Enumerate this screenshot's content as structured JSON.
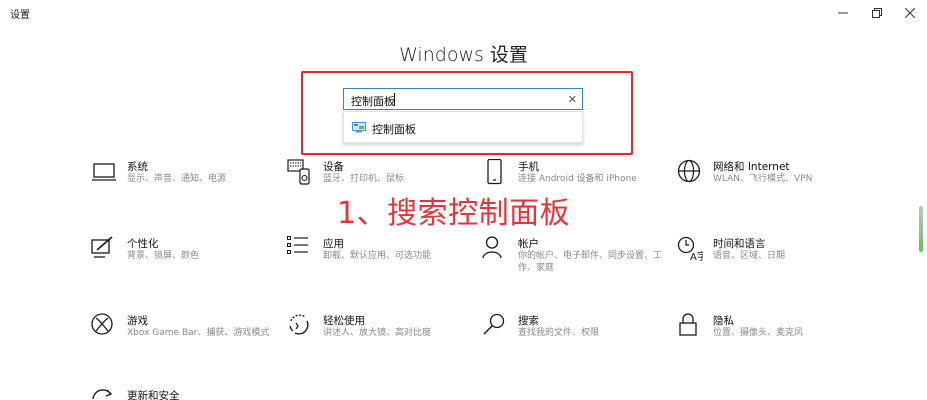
{
  "window": {
    "title": "设置",
    "minimize_icon": "minimize-icon",
    "restore_icon": "restore-icon",
    "close_icon": "close-icon"
  },
  "page": {
    "title": "Windows 设置"
  },
  "search": {
    "value": "控制面板",
    "clear_icon": "close-icon"
  },
  "suggestion": {
    "label": "控制面板",
    "icon": "control-panel-icon"
  },
  "annotation": {
    "text": "1、搜索控制面板",
    "color": "#e5343b"
  },
  "highlight_color": "#e0282e",
  "tiles": [
    {
      "name": "系统",
      "desc": "显示、声音、通知、电源",
      "icon": "laptop-icon"
    },
    {
      "name": "设备",
      "desc": "蓝牙、打印机、鼠标",
      "icon": "devices-icon"
    },
    {
      "name": "手机",
      "desc": "连接 Android 设备和 iPhone",
      "icon": "phone-icon"
    },
    {
      "name": "网络和 Internet",
      "desc": "WLAN、飞行模式、VPN",
      "icon": "globe-icon"
    },
    {
      "name": "个性化",
      "desc": "背景、锁屏、颜色",
      "icon": "personalization-icon"
    },
    {
      "name": "应用",
      "desc": "卸载、默认应用、可选功能",
      "icon": "apps-list-icon"
    },
    {
      "name": "帐户",
      "desc": "你的帐户、电子邮件、同步设置、工作、家庭",
      "icon": "person-icon"
    },
    {
      "name": "时间和语言",
      "desc": "语音、区域、日期",
      "icon": "time-language-icon"
    },
    {
      "name": "游戏",
      "desc": "Xbox Game Bar、捕获、游戏模式",
      "icon": "xbox-icon"
    },
    {
      "name": "轻松使用",
      "desc": "讲述人、放大镜、高对比度",
      "icon": "ease-of-access-icon"
    },
    {
      "name": "搜索",
      "desc": "查找我的文件、权限",
      "icon": "search-icon"
    },
    {
      "name": "隐私",
      "desc": "位置、摄像头、麦克风",
      "icon": "lock-icon"
    },
    {
      "name": "更新和安全",
      "desc": "",
      "icon": "update-icon"
    }
  ]
}
